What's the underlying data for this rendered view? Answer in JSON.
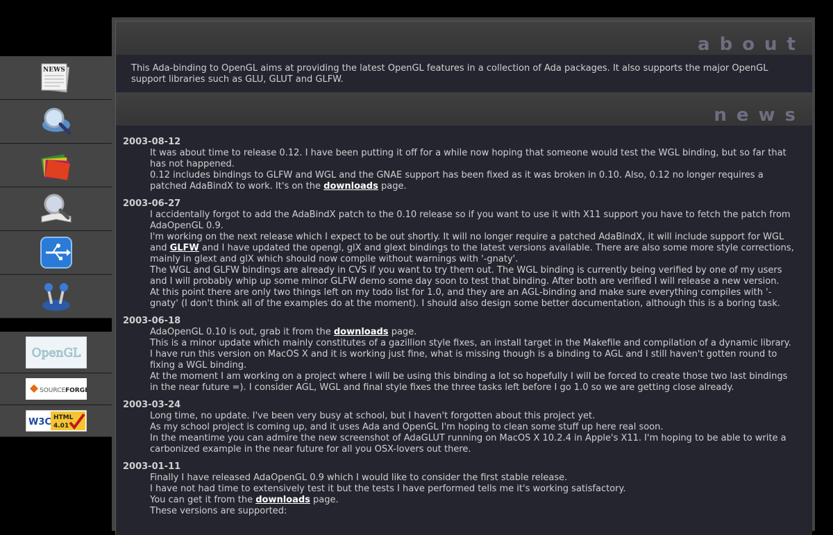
{
  "sidebar": {
    "nav": [
      {
        "name": "news",
        "icon": "newspaper-icon",
        "label": "NEWS"
      },
      {
        "name": "search",
        "icon": "magnifier-icon"
      },
      {
        "name": "books",
        "icon": "books-icon"
      },
      {
        "name": "docs",
        "icon": "book-magnifier-icon"
      },
      {
        "name": "download",
        "icon": "usb-icon"
      },
      {
        "name": "games",
        "icon": "joystick-icon"
      }
    ],
    "badges": {
      "opengl": "OpenGL",
      "sourceforge_a": "SOURCE",
      "sourceforge_b": "FORGE",
      "w3c": "W3C",
      "html_a": "HTML",
      "html_b": "4.01"
    }
  },
  "about": {
    "heading": "about",
    "text": "This Ada-binding to OpenGL aims at providing the latest OpenGL features in a collection of Ada packages. It also supports the major OpenGL support libraries such as GLU, GLUT and GLFW."
  },
  "news": {
    "heading": "news",
    "items": [
      {
        "date": "2003-08-12",
        "p1": "It was about time to release 0.12. I have been putting it off for a while now hoping that someone would test the WGL binding, but so far that has not happened.",
        "p2a": "0.12 includes bindings to GLFW and WGL and the GNAE support has been fixed as it was broken in 0.10. Also, 0.12 no longer requires a patched AdaBindX to work. It's on the ",
        "p2link": "downloads",
        "p2b": " page."
      },
      {
        "date": "2003-06-27",
        "p1": "I accidentally forgot to add the AdaBindX patch to the 0.10 release so if you want to use it with X11 support you have to fetch the patch from AdaOpenGL 0.9.",
        "p2a": "I'm working on the next release which I expect to be out shortly. It will no longer require a patched AdaBindX, it will include support for WGL and ",
        "p2link": "GLFW",
        "p2b": " and I have updated the opengl, glX and glext bindings to the latest versions available. There are also some more style corrections, mainly in glext and glX which should now compile without warnings with '-gnaty'.",
        "p3": "The WGL and GLFW bindings are already in CVS if you want to try them out. The WGL binding is currently being verified by one of my users and I will probably whip up some minor GLFW demo some day soon to test that binding. After both are verified I will release a new version.",
        "p4": "At this point there are only two things left on my todo list for 1.0, and they are an AGL-binding and make sure everything compiles with '-gnaty' (I don't think all of the examples do at the moment). I should also design some better documentation, although this is a boring task."
      },
      {
        "date": "2003-06-18",
        "p1a": "AdaOpenGL 0.10 is out, grab it from the ",
        "p1link": "downloads",
        "p1b": " page.",
        "p2": "This is a minor update which mainly constitutes of a gazillion style fixes, an install target in the Makefile and compilation of a dynamic library.",
        "p3": "I have run this version on MacOS X and it is working just fine, what is missing though is a binding to AGL and I still haven't gotten round to fixing a WGL binding.",
        "p4": "At the moment I am working on a project where I will be using this binding a lot so hopefully I will be forced to create those two last bindings in the near future =). I consider AGL, WGL and final style fixes the three tasks left before I go 1.0 so we are getting close already."
      },
      {
        "date": "2003-03-24",
        "p1": "Long time, no update. I've been very busy at school, but I haven't forgotten about this project yet.",
        "p2": "As my school project is coming up, and it uses Ada and OpenGL I'm hoping to clean some stuff up here real soon.",
        "p3": "In the meantime you can admire the new screenshot of AdaGLUT running on MacOS X 10.2.4 in Apple's X11. I'm hoping to be able to write a carbonized example in the near future for all you OSX-lovers out there."
      },
      {
        "date": "2003-01-11",
        "p1": "Finally I have released AdaOpenGL 0.9 which I would like to consider the first stable release.",
        "p2": "I have not had time to extensively test it but the tests I have performed tells me it's working satisfactory.",
        "p3a": "You can get it from the ",
        "p3link": "downloads",
        "p3b": " page.",
        "p4": "These versions are supported:"
      }
    ]
  }
}
